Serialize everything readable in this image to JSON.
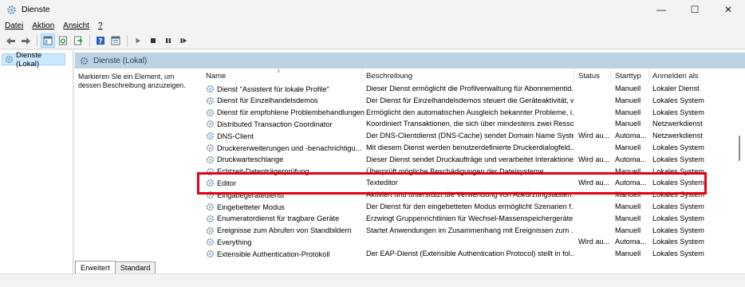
{
  "window": {
    "title": "Dienste",
    "minimize": "—",
    "maximize": "☐",
    "close": "✕"
  },
  "menu": [
    "Datei",
    "Aktion",
    "Ansicht",
    "?"
  ],
  "tree": {
    "item": "Dienste (Lokal)"
  },
  "content": {
    "header": "Dienste (Lokal)",
    "description": "Markieren Sie ein Element, um dessen Beschreibung anzuzeigen."
  },
  "columns": [
    "Name",
    "Beschreibung",
    "Status",
    "Starttyp",
    "Anmelden als"
  ],
  "rows": [
    [
      "Dienst \"Assistent für lokale Profile\"",
      "Dieser Dienst ermöglicht die Profilverwaltung für Abonnementid...",
      "",
      "Manuell",
      "Lokaler Dienst"
    ],
    [
      "Dienst für Einzelhandelsdemos",
      "Der Dienst für Einzelhandelsdemos steuert die Geräteaktivität, w...",
      "",
      "Manuell",
      "Lokales System"
    ],
    [
      "Dienst für empfohlene Problembehandlungen",
      "Ermöglicht den automatischen Ausgleich bekannter Probleme, i...",
      "",
      "Manuell",
      "Lokales System"
    ],
    [
      "Distributed Transaction Coordinator",
      "Koordiniert Transaktionen, die sich über mindestens zwei Resso...",
      "",
      "Manuell",
      "Netzwerkdienst"
    ],
    [
      "DNS-Client",
      "Der DNS-Clientdienst (DNS-Cache) sendet Domain Name Syste...",
      "Wird au...",
      "Automa...",
      "Netzwerkdienst"
    ],
    [
      "Druckererweiterungen und -benachrichtigu...",
      "Mit diesem Dienst werden benutzerdefinierte Druckerdialogfeld...",
      "",
      "Manuell",
      "Lokales System"
    ],
    [
      "Druckwarteschlange",
      "Dieser Dienst sendet Druckaufträge und verarbeitet Interaktione...",
      "Wird au...",
      "Automa...",
      "Lokales System"
    ],
    [
      "Echtzeit-Datenträgerprüfung",
      "Überprüft mögliche Beschädigungen der Dateisysteme",
      "",
      "Manuell",
      "Lokales System"
    ],
    [
      "Editor",
      "Texteditor",
      "Wird au...",
      "Automa...",
      "Lokales System"
    ],
    [
      "Eingabegerätedienst",
      "Aktiviert und unterstützt die Verwendung von Abkürzungstasten...",
      "",
      "Manuell",
      "Lokales System"
    ],
    [
      "Eingebetteter Modus",
      "Der Dienst für den eingebetteten Modus ermöglicht Szenarien f...",
      "",
      "Manuell",
      "Lokales System"
    ],
    [
      "Enumeratordienst für tragbare Geräte",
      "Erzwingt Gruppenrichtlinien für Wechsel-Massenspeichergeräte...",
      "",
      "Manuell",
      "Lokales System"
    ],
    [
      "Ereignisse zum Abrufen von Standbildern",
      "Startet Anwendungen im Zusammenhang mit Ereignissen zum ...",
      "",
      "Manuell",
      "Lokales System"
    ],
    [
      "Everything",
      "",
      "Wird au...",
      "Automa...",
      "Lokales System"
    ],
    [
      "Extensible Authentication-Protokoll",
      "Der EAP-Dienst (Extensible Authentication Protocol) stellt in fol...",
      "",
      "Manuell",
      "Lokales System"
    ]
  ],
  "tabs": [
    "Erweitert",
    "Standard"
  ],
  "colors": {
    "highlight": "#e60012",
    "header_band": "#bcd2e3",
    "tree_selected": "#cce8ff"
  }
}
